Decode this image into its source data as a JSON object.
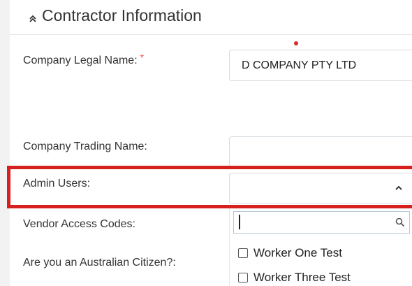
{
  "section": {
    "title": "Contractor Information",
    "collapse_icon": "chevron-double-up-icon"
  },
  "fields": {
    "company_legal_name": {
      "label": "Company Legal Name:",
      "required_mark": "*",
      "value": "D COMPANY PTY LTD"
    },
    "company_trading_name": {
      "label": "Company Trading Name:",
      "value": ""
    },
    "admin_users": {
      "label": "Admin Users:",
      "value": "",
      "icon": "caret-up-icon"
    },
    "vendor_access_codes": {
      "label": "Vendor Access Codes:"
    },
    "australian_citizen": {
      "label": "Are you an Australian Citizen?:"
    }
  },
  "dropdown": {
    "search_value": "",
    "search_icon": "search-icon",
    "options": [
      {
        "label": "Worker One Test",
        "checked": false
      },
      {
        "label": "Worker Three Test",
        "checked": false
      }
    ]
  },
  "colors": {
    "highlight": "#d61f1f",
    "required": "#e35656",
    "border": "#d5dbe1"
  }
}
